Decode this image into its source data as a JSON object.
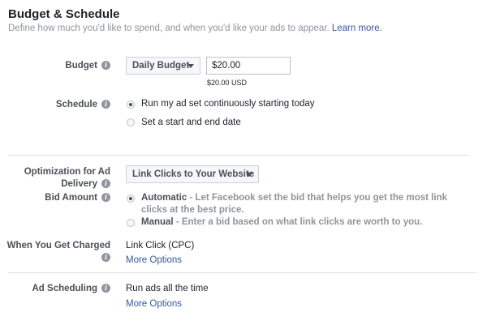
{
  "section": {
    "title": "Budget & Schedule",
    "subtitle": "Define how much you'd like to spend, and when you'd like your ads to appear.",
    "learn_more": "Learn more."
  },
  "budget": {
    "label": "Budget",
    "type_selected": "Daily Budget",
    "amount": "$20.00",
    "amount_note": "$20.00 USD"
  },
  "schedule": {
    "label": "Schedule",
    "options": [
      "Run my ad set continuously starting today",
      "Set a start and end date"
    ],
    "selected_index": 0
  },
  "optimization": {
    "label_line1": "Optimization for Ad",
    "label_line2": "Delivery",
    "selected": "Link Clicks to Your Website"
  },
  "bid": {
    "label": "Bid Amount",
    "automatic_title": "Automatic",
    "automatic_desc": " - Let Facebook set the bid that helps you get the most link clicks at the best price.",
    "manual_title": "Manual",
    "manual_desc": " - Enter a bid based on what link clicks are worth to you.",
    "selected_index": 0
  },
  "charged": {
    "label": "When You Get Charged",
    "value": "Link Click (CPC)",
    "more": "More Options"
  },
  "ad_scheduling": {
    "label": "Ad Scheduling",
    "value": "Run ads all the time",
    "more": "More Options"
  },
  "icons": {
    "info": "info-icon",
    "dropdown": "caret-down-icon"
  },
  "colors": {
    "link": "#365899",
    "muted_text": "#90949c",
    "label_text": "#4b4f56",
    "divider": "#dddfe2"
  }
}
